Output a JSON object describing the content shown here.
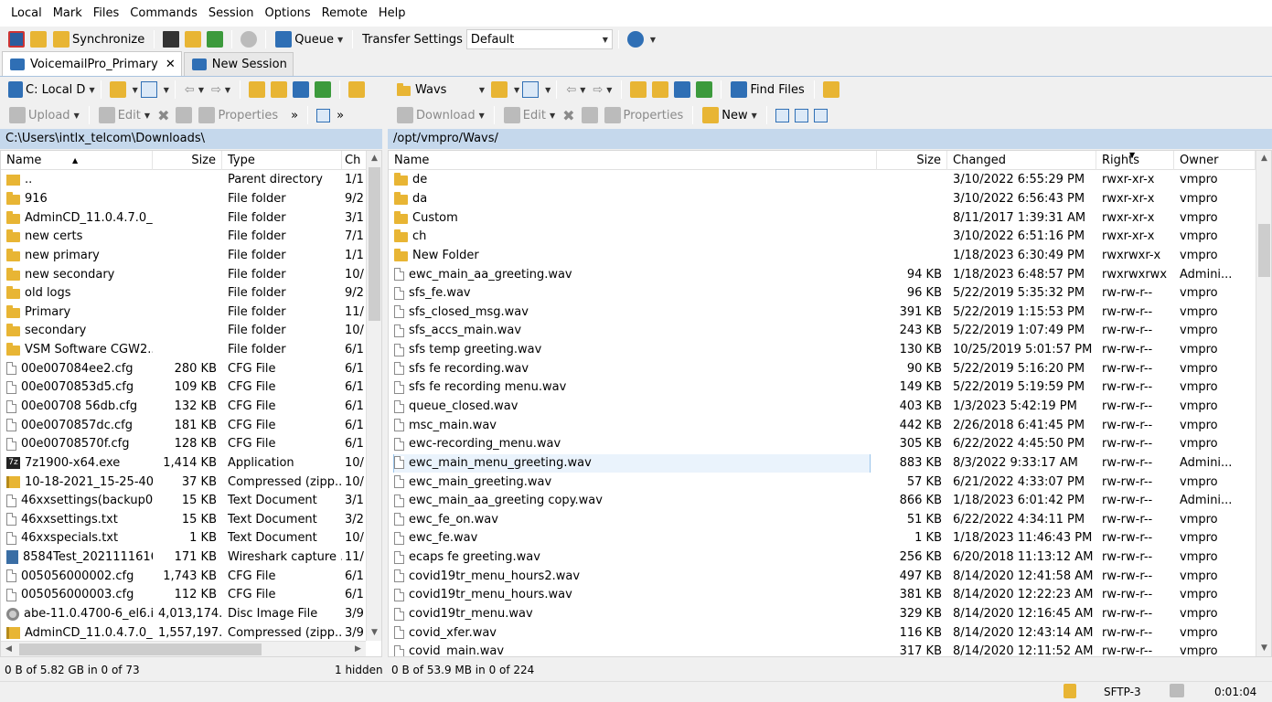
{
  "menu": [
    "Local",
    "Mark",
    "Files",
    "Commands",
    "Session",
    "Options",
    "Remote",
    "Help"
  ],
  "toolbar": {
    "synchronize": "Synchronize",
    "queue": "Queue",
    "transfer_settings_label": "Transfer Settings",
    "transfer_settings_value": "Default"
  },
  "tabs": [
    {
      "label": "VoicemailPro_Primary",
      "close": "✕"
    },
    {
      "label": "New Session"
    }
  ],
  "left": {
    "drive": "C: Local D",
    "upload": "Upload",
    "edit": "Edit",
    "properties": "Properties",
    "more": "»",
    "path": "C:\\Users\\intlx_telcom\\Downloads\\",
    "columns": [
      "Name",
      "Size",
      "Type",
      "Ch"
    ],
    "rows": [
      {
        "icon": "updir",
        "name": "..",
        "size": "",
        "type": "Parent directory",
        "ch": "1/1"
      },
      {
        "icon": "folder",
        "name": "916",
        "size": "",
        "type": "File folder",
        "ch": "9/2"
      },
      {
        "icon": "folder",
        "name": "AdminCD_11.0.4.7.0_...",
        "size": "",
        "type": "File folder",
        "ch": "3/1"
      },
      {
        "icon": "folder",
        "name": "new certs",
        "size": "",
        "type": "File folder",
        "ch": "7/1"
      },
      {
        "icon": "folder",
        "name": "new primary",
        "size": "",
        "type": "File folder",
        "ch": "1/1"
      },
      {
        "icon": "folder",
        "name": "new secondary",
        "size": "",
        "type": "File folder",
        "ch": "10/"
      },
      {
        "icon": "folder",
        "name": "old logs",
        "size": "",
        "type": "File folder",
        "ch": "9/2"
      },
      {
        "icon": "folder",
        "name": "Primary",
        "size": "",
        "type": "File folder",
        "ch": "11/"
      },
      {
        "icon": "folder",
        "name": "secondary",
        "size": "",
        "type": "File folder",
        "ch": "10/"
      },
      {
        "icon": "folder",
        "name": "VSM Software CGW2...",
        "size": "",
        "type": "File folder",
        "ch": "6/1"
      },
      {
        "icon": "doc",
        "name": "00e007084ee2.cfg",
        "size": "280 KB",
        "type": "CFG File",
        "ch": "6/1"
      },
      {
        "icon": "doc",
        "name": "00e0070853d5.cfg",
        "size": "109 KB",
        "type": "CFG File",
        "ch": "6/1"
      },
      {
        "icon": "doc",
        "name": "00e00708 56db.cfg",
        "size": "132 KB",
        "type": "CFG File",
        "ch": "6/1"
      },
      {
        "icon": "doc",
        "name": "00e0070857dc.cfg",
        "size": "181 KB",
        "type": "CFG File",
        "ch": "6/1"
      },
      {
        "icon": "doc",
        "name": "00e00708570f.cfg",
        "size": "128 KB",
        "type": "CFG File",
        "ch": "6/1"
      },
      {
        "icon": "exe7z",
        "name": "7z1900-x64.exe",
        "size": "1,414 KB",
        "type": "Application",
        "ch": "10/"
      },
      {
        "icon": "zip",
        "name": "10-18-2021_15-25-40_...",
        "size": "37 KB",
        "type": "Compressed (zipp...",
        "ch": "10/"
      },
      {
        "icon": "doc",
        "name": "46xxsettings(backup0...",
        "size": "15 KB",
        "type": "Text Document",
        "ch": "3/1"
      },
      {
        "icon": "doc",
        "name": "46xxsettings.txt",
        "size": "15 KB",
        "type": "Text Document",
        "ch": "3/2"
      },
      {
        "icon": "doc",
        "name": "46xxspecials.txt",
        "size": "1 KB",
        "type": "Text Document",
        "ch": "10/"
      },
      {
        "icon": "shark",
        "name": "8584Test_2021111616...",
        "size": "171 KB",
        "type": "Wireshark capture ...",
        "ch": "11/"
      },
      {
        "icon": "doc",
        "name": "005056000002.cfg",
        "size": "1,743 KB",
        "type": "CFG File",
        "ch": "6/1"
      },
      {
        "icon": "doc",
        "name": "005056000003.cfg",
        "size": "112 KB",
        "type": "CFG File",
        "ch": "6/1"
      },
      {
        "icon": "disc",
        "name": "abe-11.0.4700-6_el6.iso",
        "size": "4,013,174...",
        "type": "Disc Image File",
        "ch": "3/9"
      },
      {
        "icon": "zip",
        "name": "AdminCD_11.0.4.7.0_...",
        "size": "1,557,197...",
        "type": "Compressed (zipp...",
        "ch": "3/9"
      }
    ],
    "status": "0 B of 5.82 GB in 0 of 73",
    "hidden": "1 hidden"
  },
  "right": {
    "folder": "Wavs",
    "find_files": "Find Files",
    "download": "Download",
    "edit": "Edit",
    "properties": "Properties",
    "new": "New",
    "path": "/opt/vmpro/Wavs/",
    "columns": [
      "Name",
      "Size",
      "Changed",
      "Rights",
      "Owner"
    ],
    "rows": [
      {
        "icon": "folder",
        "name": "de",
        "size": "",
        "changed": "3/10/2022 6:55:29 PM",
        "rights": "rwxr-xr-x",
        "owner": "vmpro"
      },
      {
        "icon": "folder",
        "name": "da",
        "size": "",
        "changed": "3/10/2022 6:56:43 PM",
        "rights": "rwxr-xr-x",
        "owner": "vmpro"
      },
      {
        "icon": "folder",
        "name": "Custom",
        "size": "",
        "changed": "8/11/2017 1:39:31 AM",
        "rights": "rwxr-xr-x",
        "owner": "vmpro"
      },
      {
        "icon": "folder",
        "name": "ch",
        "size": "",
        "changed": "3/10/2022 6:51:16 PM",
        "rights": "rwxr-xr-x",
        "owner": "vmpro"
      },
      {
        "icon": "folder",
        "name": "New Folder",
        "size": "",
        "changed": "1/18/2023 6:30:49 PM",
        "rights": "rwxrwxr-x",
        "owner": "vmpro"
      },
      {
        "icon": "doc",
        "name": "ewc_main_aa_greeting.wav",
        "size": "94 KB",
        "changed": "1/18/2023 6:48:57 PM",
        "rights": "rwxrwxrwx",
        "owner": "Admini..."
      },
      {
        "icon": "doc",
        "name": "sfs_fe.wav",
        "size": "96 KB",
        "changed": "5/22/2019 5:35:32 PM",
        "rights": "rw-rw-r--",
        "owner": "vmpro"
      },
      {
        "icon": "doc",
        "name": "sfs_closed_msg.wav",
        "size": "391 KB",
        "changed": "5/22/2019 1:15:53 PM",
        "rights": "rw-rw-r--",
        "owner": "vmpro"
      },
      {
        "icon": "doc",
        "name": "sfs_accs_main.wav",
        "size": "243 KB",
        "changed": "5/22/2019 1:07:49 PM",
        "rights": "rw-rw-r--",
        "owner": "vmpro"
      },
      {
        "icon": "doc",
        "name": "sfs temp greeting.wav",
        "size": "130 KB",
        "changed": "10/25/2019 5:01:57 PM",
        "rights": "rw-rw-r--",
        "owner": "vmpro"
      },
      {
        "icon": "doc",
        "name": "sfs fe recording.wav",
        "size": "90 KB",
        "changed": "5/22/2019 5:16:20 PM",
        "rights": "rw-rw-r--",
        "owner": "vmpro"
      },
      {
        "icon": "doc",
        "name": "sfs fe recording menu.wav",
        "size": "149 KB",
        "changed": "5/22/2019 5:19:59 PM",
        "rights": "rw-rw-r--",
        "owner": "vmpro"
      },
      {
        "icon": "doc",
        "name": "queue_closed.wav",
        "size": "403 KB",
        "changed": "1/3/2023 5:42:19 PM",
        "rights": "rw-rw-r--",
        "owner": "vmpro"
      },
      {
        "icon": "doc",
        "name": "msc_main.wav",
        "size": "442 KB",
        "changed": "2/26/2018 6:41:45 PM",
        "rights": "rw-rw-r--",
        "owner": "vmpro"
      },
      {
        "icon": "doc",
        "name": "ewc-recording_menu.wav",
        "size": "305 KB",
        "changed": "6/22/2022 4:45:50 PM",
        "rights": "rw-rw-r--",
        "owner": "vmpro"
      },
      {
        "icon": "doc",
        "name": "ewc_main_menu_greeting.wav",
        "size": "883 KB",
        "changed": "8/3/2022 9:33:17 AM",
        "rights": "rw-rw-r--",
        "owner": "Admini...",
        "selected": true
      },
      {
        "icon": "doc",
        "name": "ewc_main_greeting.wav",
        "size": "57 KB",
        "changed": "6/21/2022 4:33:07 PM",
        "rights": "rw-rw-r--",
        "owner": "vmpro"
      },
      {
        "icon": "doc",
        "name": "ewc_main_aa_greeting copy.wav",
        "size": "866 KB",
        "changed": "1/18/2023 6:01:42 PM",
        "rights": "rw-rw-r--",
        "owner": "Admini..."
      },
      {
        "icon": "doc",
        "name": "ewc_fe_on.wav",
        "size": "51 KB",
        "changed": "6/22/2022 4:34:11 PM",
        "rights": "rw-rw-r--",
        "owner": "vmpro"
      },
      {
        "icon": "doc",
        "name": "ewc_fe.wav",
        "size": "1 KB",
        "changed": "1/18/2023 11:46:43 PM",
        "rights": "rw-rw-r--",
        "owner": "vmpro"
      },
      {
        "icon": "doc",
        "name": "ecaps fe greeting.wav",
        "size": "256 KB",
        "changed": "6/20/2018 11:13:12 AM",
        "rights": "rw-rw-r--",
        "owner": "vmpro"
      },
      {
        "icon": "doc",
        "name": "covid19tr_menu_hours2.wav",
        "size": "497 KB",
        "changed": "8/14/2020 12:41:58 AM",
        "rights": "rw-rw-r--",
        "owner": "vmpro"
      },
      {
        "icon": "doc",
        "name": "covid19tr_menu_hours.wav",
        "size": "381 KB",
        "changed": "8/14/2020 12:22:23 AM",
        "rights": "rw-rw-r--",
        "owner": "vmpro"
      },
      {
        "icon": "doc",
        "name": "covid19tr_menu.wav",
        "size": "329 KB",
        "changed": "8/14/2020 12:16:45 AM",
        "rights": "rw-rw-r--",
        "owner": "vmpro"
      },
      {
        "icon": "doc",
        "name": "covid_xfer.wav",
        "size": "116 KB",
        "changed": "8/14/2020 12:43:14 AM",
        "rights": "rw-rw-r--",
        "owner": "vmpro"
      },
      {
        "icon": "doc",
        "name": "covid_main.wav",
        "size": "317 KB",
        "changed": "8/14/2020 12:11:52 AM",
        "rights": "rw-rw-r--",
        "owner": "vmpro"
      }
    ],
    "status": "0 B of 53.9 MB in 0 of 224"
  },
  "status": {
    "protocol": "SFTP-3",
    "time": "0:01:04"
  }
}
